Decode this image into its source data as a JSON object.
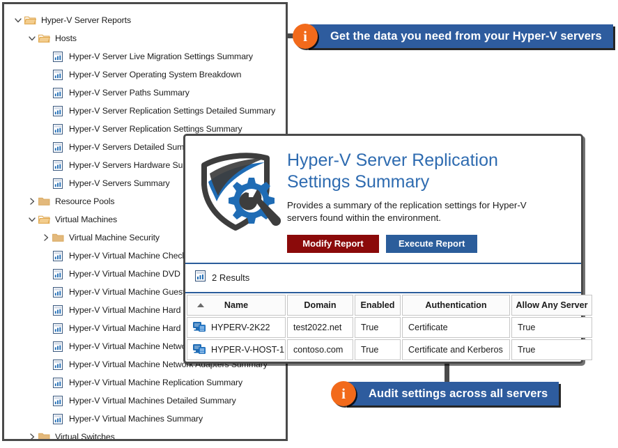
{
  "tree": {
    "items": [
      {
        "label": "Hyper-V Server Reports",
        "depth": 0,
        "icon": "folder-open-icon",
        "chevron": "down"
      },
      {
        "label": "Hosts",
        "depth": 1,
        "icon": "folder-open-icon",
        "chevron": "down"
      },
      {
        "label": "Hyper-V Server Live Migration Settings Summary",
        "depth": 2,
        "icon": "report-icon",
        "chevron": "none"
      },
      {
        "label": "Hyper-V Server Operating System Breakdown",
        "depth": 2,
        "icon": "report-icon",
        "chevron": "none"
      },
      {
        "label": "Hyper-V Server Paths Summary",
        "depth": 2,
        "icon": "report-icon",
        "chevron": "none"
      },
      {
        "label": "Hyper-V Server Replication Settings Detailed Summary",
        "depth": 2,
        "icon": "report-icon",
        "chevron": "none"
      },
      {
        "label": "Hyper-V Server Replication Settings Summary",
        "depth": 2,
        "icon": "report-icon",
        "chevron": "none"
      },
      {
        "label": "Hyper-V Servers Detailed Summary",
        "depth": 2,
        "icon": "report-icon",
        "chevron": "none"
      },
      {
        "label": "Hyper-V Servers Hardware Summary",
        "depth": 2,
        "icon": "report-icon",
        "chevron": "none"
      },
      {
        "label": "Hyper-V Servers Summary",
        "depth": 2,
        "icon": "report-icon",
        "chevron": "none"
      },
      {
        "label": "Resource Pools",
        "depth": 1,
        "icon": "folder-closed-icon",
        "chevron": "right"
      },
      {
        "label": "Virtual Machines",
        "depth": 1,
        "icon": "folder-open-icon",
        "chevron": "down"
      },
      {
        "label": "Virtual Machine Security",
        "depth": 2,
        "icon": "folder-closed-icon",
        "chevron": "right"
      },
      {
        "label": "Hyper-V Virtual Machine Checkpoint Summary",
        "depth": 2,
        "icon": "report-icon",
        "chevron": "none"
      },
      {
        "label": "Hyper-V Virtual Machine DVD Drive Summary",
        "depth": 2,
        "icon": "report-icon",
        "chevron": "none"
      },
      {
        "label": "Hyper-V Virtual Machine Guest Operating Systems",
        "depth": 2,
        "icon": "report-icon",
        "chevron": "none"
      },
      {
        "label": "Hyper-V Virtual Machine Hard Disk Detailed Summary",
        "depth": 2,
        "icon": "report-icon",
        "chevron": "none"
      },
      {
        "label": "Hyper-V Virtual Machine Hard Disk Summary",
        "depth": 2,
        "icon": "report-icon",
        "chevron": "none"
      },
      {
        "label": "Hyper-V Virtual Machine Network Adapter Detailed Summary",
        "depth": 2,
        "icon": "report-icon",
        "chevron": "none"
      },
      {
        "label": "Hyper-V Virtual Machine Network Adapters Summary",
        "depth": 2,
        "icon": "report-icon",
        "chevron": "none"
      },
      {
        "label": "Hyper-V Virtual Machine Replication Summary",
        "depth": 2,
        "icon": "report-icon",
        "chevron": "none"
      },
      {
        "label": "Hyper-V Virtual Machines Detailed Summary",
        "depth": 2,
        "icon": "report-icon",
        "chevron": "none"
      },
      {
        "label": "Hyper-V Virtual Machines Summary",
        "depth": 2,
        "icon": "report-icon",
        "chevron": "none"
      },
      {
        "label": "Virtual Switches",
        "depth": 1,
        "icon": "folder-closed-icon",
        "chevron": "right"
      }
    ]
  },
  "callouts": {
    "top": {
      "badge": "i",
      "text": "Get the data you need from your Hyper-V servers"
    },
    "bottom": {
      "badge": "i",
      "text": "Audit settings across all servers"
    }
  },
  "card": {
    "logo_icon": "shield-gear-wrench-icon",
    "title": "Hyper-V Server Replication Settings Summary",
    "description": "Provides a summary of the replication settings for Hyper-V servers found within the environment.",
    "modify_label": "Modify Report",
    "execute_label": "Execute Report",
    "results_icon": "report-icon",
    "results_label": "2 Results",
    "table": {
      "sort_column": "Name",
      "sort_direction": "ascending",
      "columns": [
        "Name",
        "Domain",
        "Enabled",
        "Authentication",
        "Allow Any Server"
      ],
      "rows": [
        {
          "icon": "server-computer-icon",
          "name": "HYPERV-2K22",
          "domain": "test2022.net",
          "enabled": "True",
          "authentication": "Certificate",
          "allow_any_server": "True"
        },
        {
          "icon": "server-computer-icon",
          "name": "HYPER-V-HOST-1",
          "domain": "contoso.com",
          "enabled": "True",
          "authentication": "Certificate and Kerberos",
          "allow_any_server": "True"
        }
      ]
    }
  },
  "colors": {
    "callout_blue": "#2e5c9e",
    "badge_orange": "#f26a1b",
    "title_blue": "#2e6bb0",
    "modify_red": "#8b0a0a",
    "execute_blue": "#2b5d9b",
    "divider_blue": "#2b5d9b",
    "folder_tan": "#e8b96b",
    "border_gray": "#4a4a4a"
  }
}
